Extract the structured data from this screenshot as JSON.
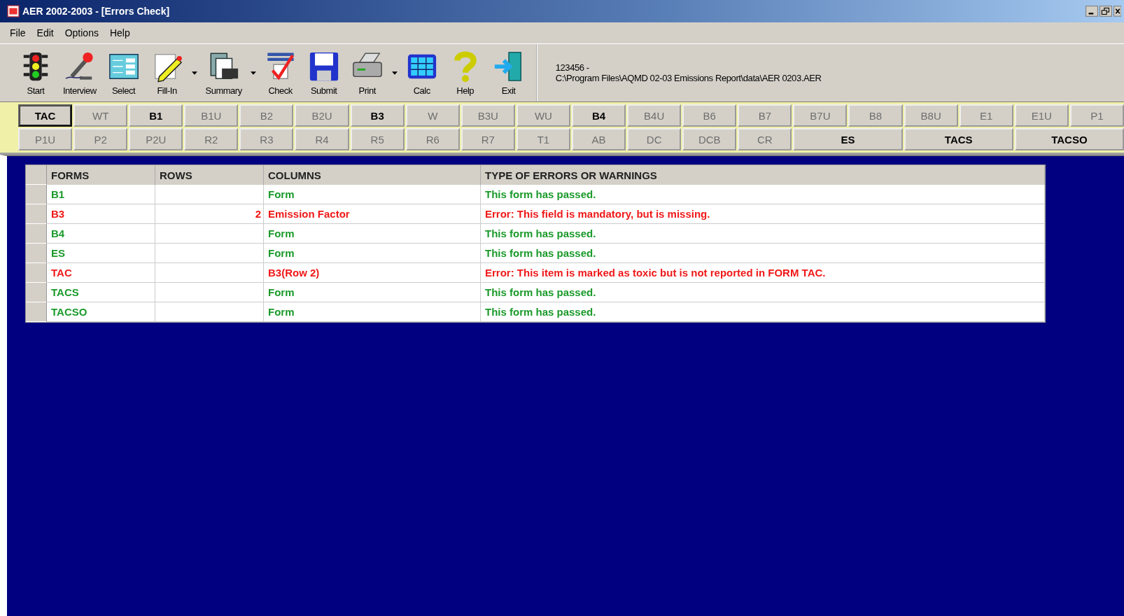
{
  "window": {
    "title": "AER 2002-2003 - [Errors Check]"
  },
  "menu": [
    "File",
    "Edit",
    "Options",
    "Help"
  ],
  "toolbar": [
    {
      "label": "Start",
      "dropdown": false
    },
    {
      "label": "Interview",
      "dropdown": false
    },
    {
      "label": "Select",
      "dropdown": false
    },
    {
      "label": "Fill-In",
      "dropdown": true
    },
    {
      "label": "Summary",
      "dropdown": true
    },
    {
      "label": "Check",
      "dropdown": false
    },
    {
      "label": "Submit",
      "dropdown": false
    },
    {
      "label": "Print",
      "dropdown": true
    },
    {
      "label": "Calc",
      "dropdown": false
    },
    {
      "label": "Help",
      "dropdown": false
    },
    {
      "label": "Exit",
      "dropdown": false
    }
  ],
  "file_info": {
    "id": "123456 -",
    "path": "C:\\Program Files\\AQMD 02-03 Emissions Report\\data\\AER 0203.AER"
  },
  "form_buttons": [
    {
      "label": "TAC",
      "enabled": true,
      "selected": true,
      "wide": false
    },
    {
      "label": "WT",
      "enabled": false,
      "selected": false,
      "wide": false
    },
    {
      "label": "B1",
      "enabled": true,
      "selected": false,
      "wide": false
    },
    {
      "label": "B1U",
      "enabled": false,
      "selected": false,
      "wide": false
    },
    {
      "label": "B2",
      "enabled": false,
      "selected": false,
      "wide": false
    },
    {
      "label": "B2U",
      "enabled": false,
      "selected": false,
      "wide": false
    },
    {
      "label": "B3",
      "enabled": true,
      "selected": false,
      "wide": false
    },
    {
      "label": "W",
      "enabled": false,
      "selected": false,
      "wide": false
    },
    {
      "label": "B3U",
      "enabled": false,
      "selected": false,
      "wide": false
    },
    {
      "label": "WU",
      "enabled": false,
      "selected": false,
      "wide": false
    },
    {
      "label": "B4",
      "enabled": true,
      "selected": false,
      "wide": false
    },
    {
      "label": "B4U",
      "enabled": false,
      "selected": false,
      "wide": false
    },
    {
      "label": "B6",
      "enabled": false,
      "selected": false,
      "wide": false
    },
    {
      "label": "B7",
      "enabled": false,
      "selected": false,
      "wide": false
    },
    {
      "label": "B7U",
      "enabled": false,
      "selected": false,
      "wide": false
    },
    {
      "label": "B8",
      "enabled": false,
      "selected": false,
      "wide": false
    },
    {
      "label": "B8U",
      "enabled": false,
      "selected": false,
      "wide": false
    },
    {
      "label": "E1",
      "enabled": false,
      "selected": false,
      "wide": false
    },
    {
      "label": "E1U",
      "enabled": false,
      "selected": false,
      "wide": false
    },
    {
      "label": "P1",
      "enabled": false,
      "selected": false,
      "wide": false
    },
    {
      "label": "P1U",
      "enabled": false,
      "selected": false,
      "wide": false
    },
    {
      "label": "P2",
      "enabled": false,
      "selected": false,
      "wide": false
    },
    {
      "label": "P2U",
      "enabled": false,
      "selected": false,
      "wide": false
    },
    {
      "label": "R2",
      "enabled": false,
      "selected": false,
      "wide": false
    },
    {
      "label": "R3",
      "enabled": false,
      "selected": false,
      "wide": false
    },
    {
      "label": "R4",
      "enabled": false,
      "selected": false,
      "wide": false
    },
    {
      "label": "R5",
      "enabled": false,
      "selected": false,
      "wide": false
    },
    {
      "label": "R6",
      "enabled": false,
      "selected": false,
      "wide": false
    },
    {
      "label": "R7",
      "enabled": false,
      "selected": false,
      "wide": false
    },
    {
      "label": "T1",
      "enabled": false,
      "selected": false,
      "wide": false
    },
    {
      "label": "AB",
      "enabled": false,
      "selected": false,
      "wide": false
    },
    {
      "label": "DC",
      "enabled": false,
      "selected": false,
      "wide": false
    },
    {
      "label": "DCB",
      "enabled": false,
      "selected": false,
      "wide": false
    },
    {
      "label": "CR",
      "enabled": false,
      "selected": false,
      "wide": false
    },
    {
      "label": "ES",
      "enabled": true,
      "selected": false,
      "wide": true
    },
    {
      "label": "TACS",
      "enabled": true,
      "selected": false,
      "wide": true
    },
    {
      "label": "TACSO",
      "enabled": true,
      "selected": false,
      "wide": true
    }
  ],
  "table": {
    "columns": [
      "FORMS",
      "ROWS",
      "COLUMNS",
      "TYPE OF ERRORS OR WARNINGS"
    ],
    "rows": [
      {
        "kind": "ok",
        "form": "B1",
        "row": "",
        "column": "Form",
        "message": "This form has passed."
      },
      {
        "kind": "error",
        "form": "B3",
        "row": "2",
        "column": "Emission Factor",
        "message": "Error: This field is mandatory, but is missing."
      },
      {
        "kind": "ok",
        "form": "B4",
        "row": "",
        "column": "Form",
        "message": "This form has passed."
      },
      {
        "kind": "ok",
        "form": "ES",
        "row": "",
        "column": "Form",
        "message": "This form has passed."
      },
      {
        "kind": "error",
        "form": "TAC",
        "row": "",
        "column": "B3(Row 2)",
        "message": "Error: This item is marked as toxic but is not reported in FORM TAC."
      },
      {
        "kind": "ok",
        "form": "TACS",
        "row": "",
        "column": "Form",
        "message": "This form has passed."
      },
      {
        "kind": "ok",
        "form": "TACSO",
        "row": "",
        "column": "Form",
        "message": "This form has passed."
      }
    ]
  }
}
